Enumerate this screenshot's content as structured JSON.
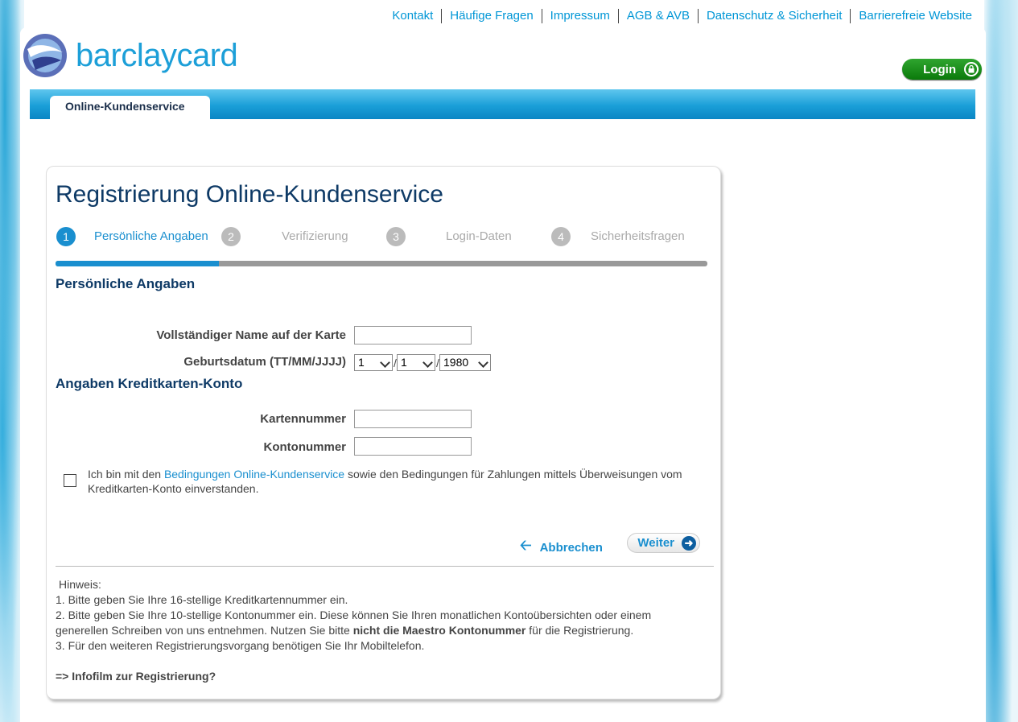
{
  "toplinks": [
    "Kontakt",
    "Häufige Fragen",
    "Impressum",
    "AGB & AVB",
    "Datenschutz & Sicherheit",
    "Barrierefreie Website"
  ],
  "brand": {
    "name": "barclaycard",
    "color": "#1c9fd8"
  },
  "login": {
    "label": "Login",
    "icon": "lock-icon"
  },
  "nav": {
    "tab_label": "Online-Kundenservice"
  },
  "form": {
    "title": "Registrierung Online-Kundenservice",
    "steps": [
      {
        "number": "1",
        "label": "Persönliche Angaben",
        "active": true
      },
      {
        "number": "2",
        "label": "Verifizierung",
        "active": false
      },
      {
        "number": "3",
        "label": "Login-Daten",
        "active": false
      },
      {
        "number": "4",
        "label": "Sicherheitsfragen",
        "active": false
      }
    ],
    "progress_fraction": 0.25,
    "section_personal": "Persönliche Angaben",
    "name_label": "Vollständiger Name auf der Karte",
    "name_value": "",
    "dob_label": "Geburtsdatum (TT/MM/JJJJ)",
    "dob_day": "1",
    "dob_month": "1",
    "dob_year": "1980",
    "section_account": "Angaben Kreditkarten-Konto",
    "card_label": "Kartennummer",
    "card_value": "",
    "account_label": "Kontonummer",
    "account_value": "",
    "agree_prefix": "Ich bin mit den ",
    "agree_link": "Bedingungen Online-Kundenservice",
    "agree_suffix": " sowie den Bedingungen für Zahlungen mittels Überweisungen vom Kreditkarten-Konto einverstanden.",
    "agree_checked": false,
    "cancel_label": "Abbrechen",
    "next_label": "Weiter",
    "hint_title": "Hinweis:",
    "hint_1": "1. Bitte geben Sie Ihre 16-stellige Kreditkartennummer ein.",
    "hint_2_a": "2. Bitte geben Sie Ihre 10-stellige Kontonummer ein. Diese können Sie Ihren monatlichen Kontoübersichten oder einem generellen Schreiben von uns entnehmen. Nutzen Sie bitte ",
    "hint_2_bold": "nicht die Maestro Kontonummer",
    "hint_2_b": " für die Registrierung.",
    "hint_3": "3. Für den weiteren Registrierungsvorgang benötigen Sie Ihr Mobiltelefon.",
    "info_link": "=> Infofilm zur Registrierung?"
  },
  "colors": {
    "accent": "#1a8fcf",
    "title": "#0e3a66",
    "login_green": "#1b8f1b"
  }
}
